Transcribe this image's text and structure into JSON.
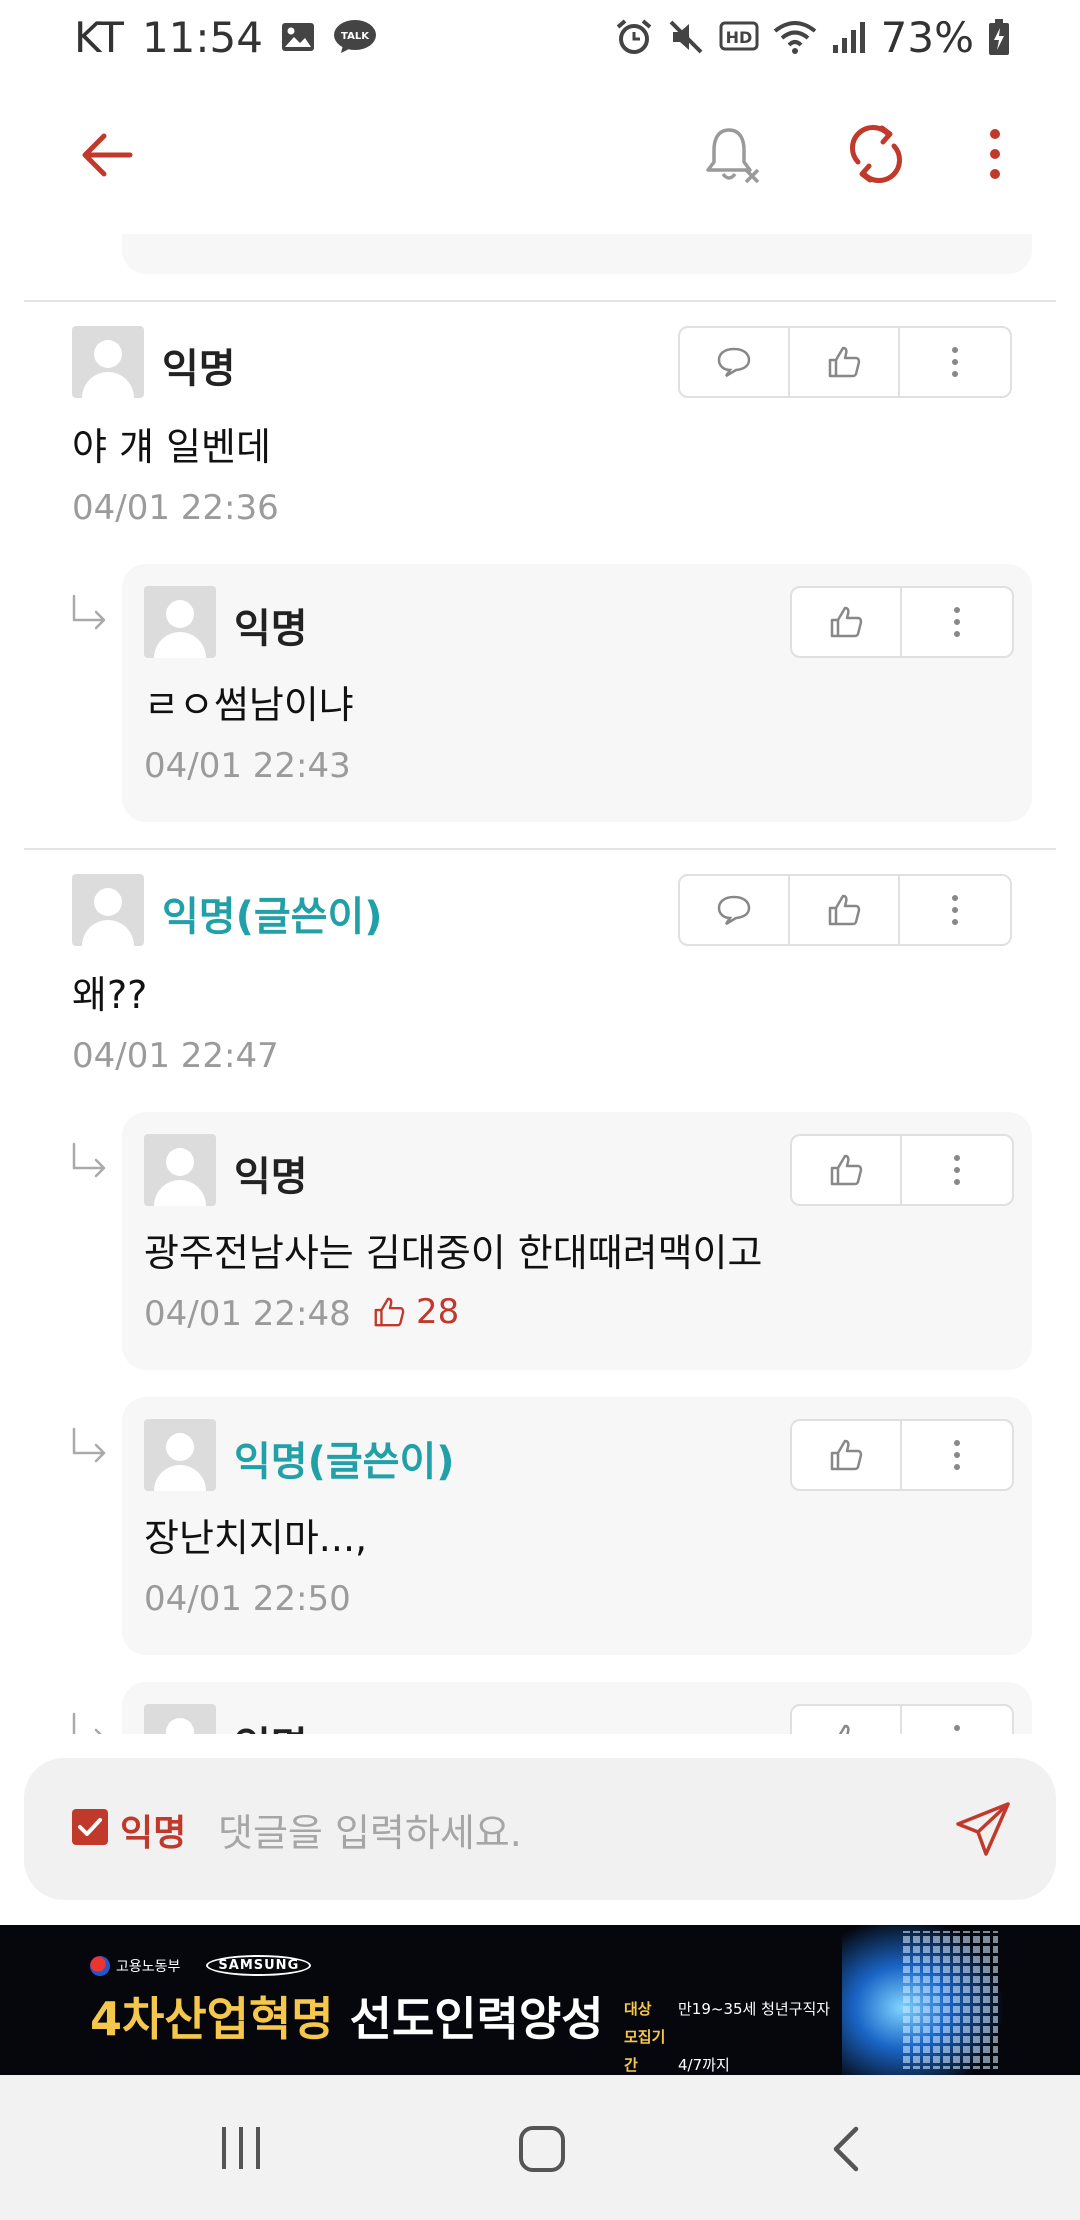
{
  "status_bar": {
    "carrier": "KT",
    "time": "11:54",
    "talk_badge": "TALK",
    "hd_badge": "HD",
    "battery_percent": "73%"
  },
  "app_bar": {
    "icons": [
      "back-arrow-icon",
      "bell-off-icon",
      "refresh-icon",
      "more-vert-icon"
    ],
    "accent_color": "#c0392b"
  },
  "comments": [
    {
      "name": "익명",
      "is_author": false,
      "text": "야 걔 일벤데",
      "time": "04/01 22:36",
      "replies": [
        {
          "name": "익명",
          "is_author": false,
          "text": "ㄹㅇ썸남이냐",
          "time": "04/01 22:43",
          "likes": ""
        }
      ]
    },
    {
      "name": "익명(글쓴이)",
      "is_author": true,
      "text": "왜??",
      "time": "04/01 22:47",
      "replies": [
        {
          "name": "익명",
          "is_author": false,
          "text": "광주전남사는 김대중이 한대때려맥이고",
          "time": "04/01 22:48",
          "likes": "28"
        },
        {
          "name": "익명(글쓴이)",
          "is_author": true,
          "text": "장난치지마...,",
          "time": "04/01 22:50",
          "likes": ""
        },
        {
          "name": "익명",
          "is_author": false,
          "text": "",
          "time": "",
          "likes": ""
        }
      ]
    }
  ],
  "author_color": "#22a0a8",
  "input_bar": {
    "anonymous_label": "익명",
    "anonymous_checked": true,
    "placeholder": "댓글을 입력하세요."
  },
  "banner": {
    "gov_logo_text": "고용노동부",
    "samsung_logo_text": "SAMSUNG",
    "headline_highlight": "4차산업혁명",
    "headline_rest": "선도인력양성",
    "info_label_1": "대상",
    "info_value_1": "만19~35세 청년구직자",
    "info_label_2": "모집기간",
    "info_value_2": "4/7까지"
  }
}
